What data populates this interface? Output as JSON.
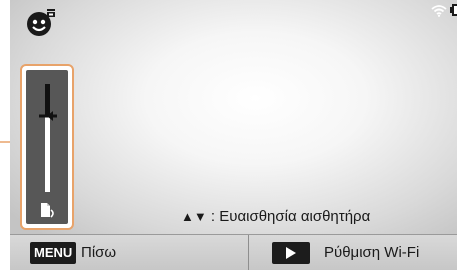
{
  "status": {
    "mode_icon": "smart-face-icon",
    "wifi_icon": "wifi-icon",
    "battery_icon": "battery-icon"
  },
  "sensitivity": {
    "icon": "sensor-icon",
    "level": 0.7
  },
  "hint": {
    "arrows": "▲▼",
    "text": ": Ευαισθησία αισθητήρα"
  },
  "bottom_bar": {
    "menu_key": "MENU",
    "back_label": "Πίσω",
    "play_icon": "play-icon",
    "wifi_setup_label": "Ρύθμιση Wi-Fi"
  },
  "colors": {
    "callout": "#e8a36a",
    "bar_background": "#d0d0d0",
    "key_background": "#1c1c1c"
  }
}
